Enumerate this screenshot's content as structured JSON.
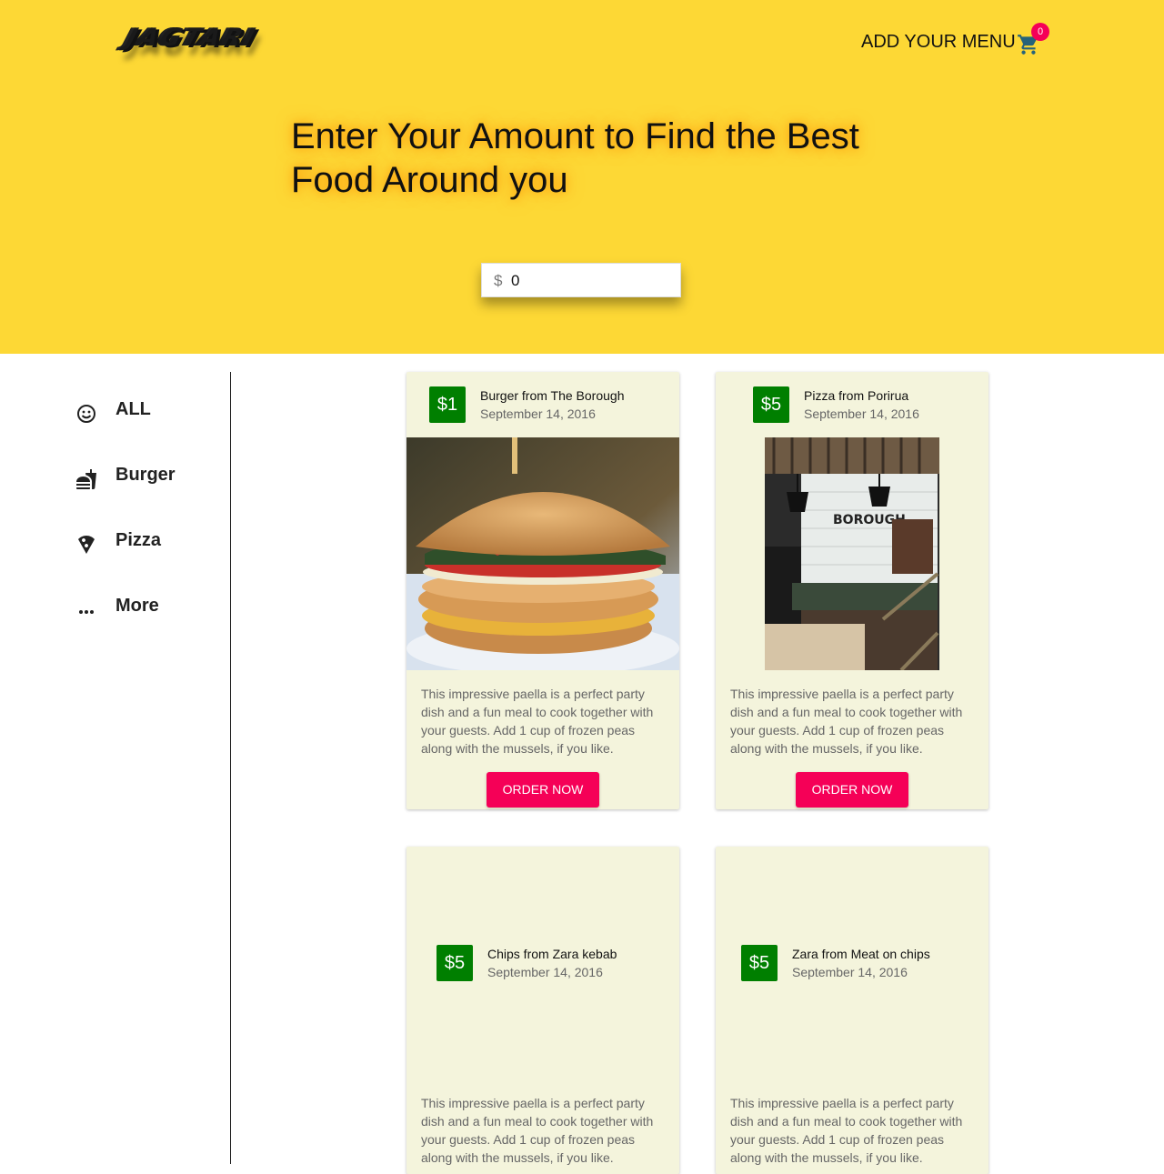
{
  "header": {
    "logo_text": "JAGTARI",
    "add_menu_label": "ADD YOUR MENU",
    "cart_count": "0"
  },
  "hero": {
    "headline": "Enter Your Amount to Find the Best Food Around you",
    "amount_prefix": "$",
    "amount_value": "0"
  },
  "sidebar": {
    "items": [
      {
        "label": "ALL",
        "icon": "smiley-icon"
      },
      {
        "label": "Burger",
        "icon": "fastfood-icon"
      },
      {
        "label": "Pizza",
        "icon": "pizza-icon"
      },
      {
        "label": "More",
        "icon": "more-horiz-icon"
      }
    ]
  },
  "cards": [
    {
      "price": "$1",
      "title": "Burger from The Borough",
      "date": "September 14, 2016",
      "image": "burger photo",
      "description": "This impressive paella is a perfect party dish and a fun meal to cook together with your guests. Add 1 cup of frozen peas along with the mussels, if you like.",
      "button": "ORDER NOW"
    },
    {
      "price": "$5",
      "title": "Pizza from Porirua",
      "date": "September 14, 2016",
      "image": "cafe interior photo",
      "image_sign": "BOROUGH",
      "description": "This impressive paella is a perfect party dish and a fun meal to cook together with your guests. Add 1 cup of frozen peas along with the mussels, if you like.",
      "button": "ORDER NOW"
    },
    {
      "price": "$5",
      "title": "Chips from Zara kebab",
      "date": "September 14, 2016",
      "description": "This impressive paella is a perfect party dish and a fun meal to cook together with your guests. Add 1 cup of frozen peas along with the mussels, if you like."
    },
    {
      "price": "$5",
      "title": "Zara from Meat on chips",
      "date": "September 14, 2016",
      "description": "This impressive paella is a perfect party dish and a fun meal to cook together with your guests. Add 1 cup of frozen peas along with the mussels, if you like."
    }
  ],
  "colors": {
    "hero_bg": "#fdd835",
    "accent": "#f50057",
    "price_badge": "#007f00",
    "card_bg": "#f4f4dc",
    "cart_icon": "#26637a"
  }
}
